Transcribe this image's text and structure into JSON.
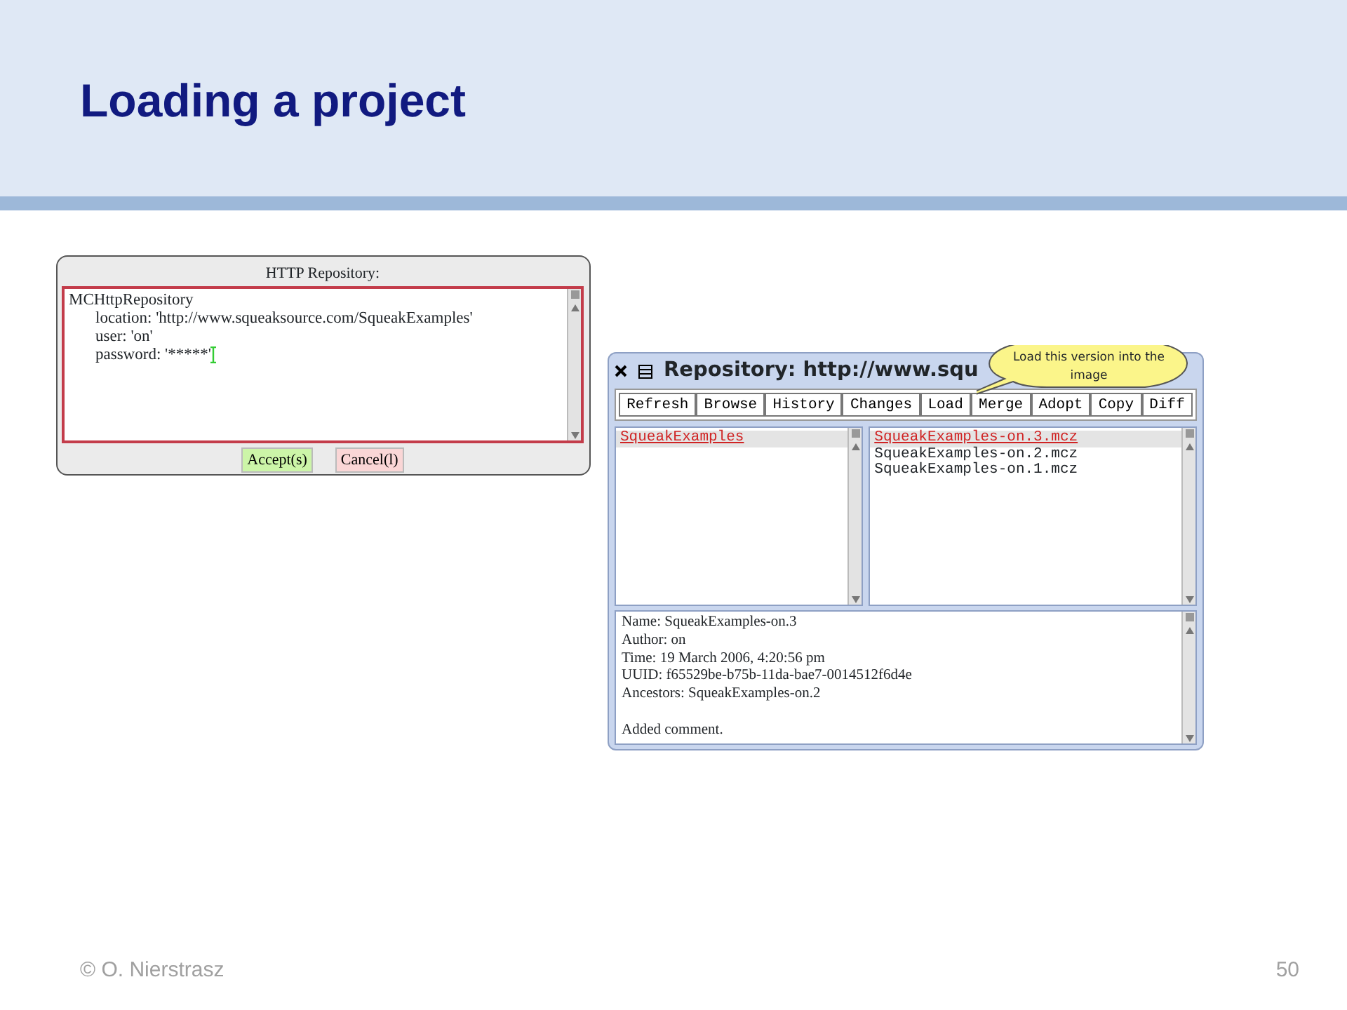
{
  "slide": {
    "title": "Loading a project",
    "footer": "© O. Nierstrasz",
    "page_number": "50"
  },
  "dialog": {
    "title": "HTTP Repository:",
    "lines": [
      {
        "kind": "class",
        "text": "MCHttpRepository"
      },
      {
        "kind": "attribute",
        "text": "location: 'http://www.squeaksource.com/SqueakExamples'"
      },
      {
        "kind": "attribute",
        "text": "user: 'on'"
      },
      {
        "kind": "attribute",
        "text": "password: '*****'",
        "cursor": true
      }
    ],
    "buttons": [
      {
        "kind": "accept",
        "label": "Accept(s)"
      },
      {
        "kind": "cancel",
        "label": "Cancel(l)"
      }
    ]
  },
  "repository_window": {
    "title": "Repository: http://www.squ",
    "tooltip": "Load this version into the image",
    "toolbar": [
      "Refresh",
      "Browse",
      "History",
      "Changes",
      "Load",
      "Merge",
      "Adopt",
      "Copy",
      "Diff"
    ],
    "packages": [
      {
        "label": "SqueakExamples",
        "selected": true
      }
    ],
    "versions": [
      {
        "label": "SqueakExamples-on.3.mcz",
        "selected": true
      },
      {
        "label": "SqueakExamples-on.2.mcz",
        "selected": false
      },
      {
        "label": "SqueakExamples-on.1.mcz",
        "selected": false
      }
    ],
    "details": [
      "Name: SqueakExamples-on.3",
      "Author: on",
      "Time: 19 March 2006, 4:20:56 pm",
      "UUID: f65529be-b75b-11da-bae7-0014512f6d4e",
      "Ancestors: SqueakExamples-on.2"
    ],
    "comment": "Added comment."
  }
}
